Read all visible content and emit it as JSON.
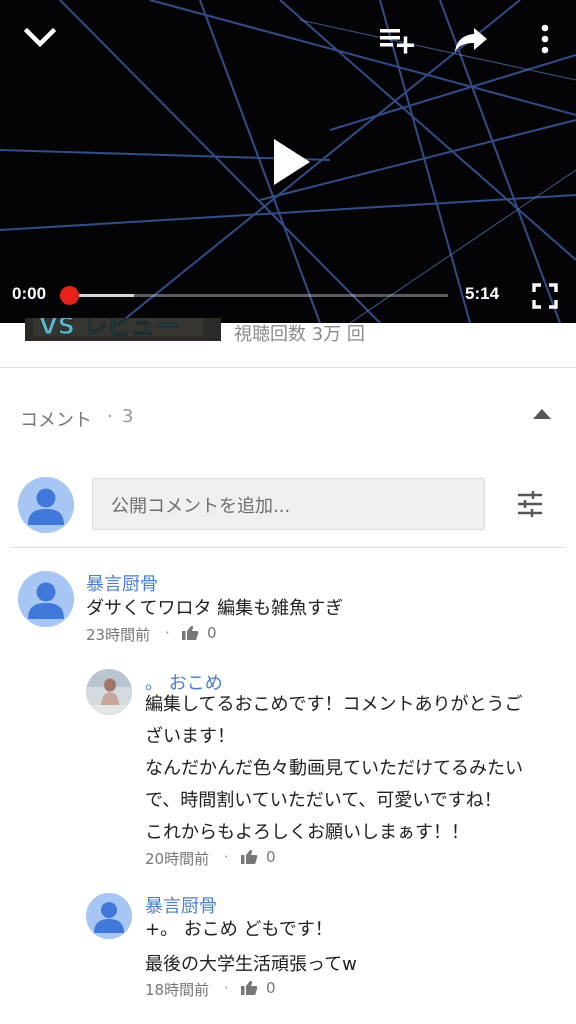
{
  "player": {
    "current_time": "0:00",
    "duration": "5:14",
    "buffered_fraction": 0.17,
    "played_fraction": 0.0,
    "icons": [
      "chevron-down-icon",
      "add-to-queue-icon",
      "share-icon",
      "more-vert-icon",
      "play-icon",
      "fullscreen-icon"
    ]
  },
  "video_info": {
    "views": "視聴回数 3万 回",
    "thumbnail_text": "VS レビュー"
  },
  "comments_header": {
    "title": "コメント",
    "separator": "·",
    "count": "3"
  },
  "comment_input": {
    "placeholder": "公開コメントを追加..."
  },
  "comments": [
    {
      "author": "暴言厨骨",
      "lines": [
        "ダサくてワロタ 編集も雑魚すぎ"
      ],
      "time": "23時間前",
      "likes": "0"
    }
  ],
  "replies": [
    {
      "author": "。 おこめ",
      "lines": [
        "編集してるおこめです！コメントありがとうご",
        "ざいます！",
        "なんだかんだ色々動画見ていただけてるみたい",
        "で、時間割いていただいて、可愛いですね！",
        "これからもよろしくお願いしまぁす！！"
      ],
      "time": "20時間前",
      "likes": "0"
    },
    {
      "author": "暴言厨骨",
      "lines": [
        "+。 おこめ どもです！",
        "最後の大学生活頑張ってw"
      ],
      "time": "18時間前",
      "likes": "0"
    }
  ],
  "colors": {
    "author_link": "#4a7fc9",
    "scrubber": "#e62117",
    "avatar_bg": "#a8c6f3",
    "avatar_fg": "#3f78d8"
  }
}
